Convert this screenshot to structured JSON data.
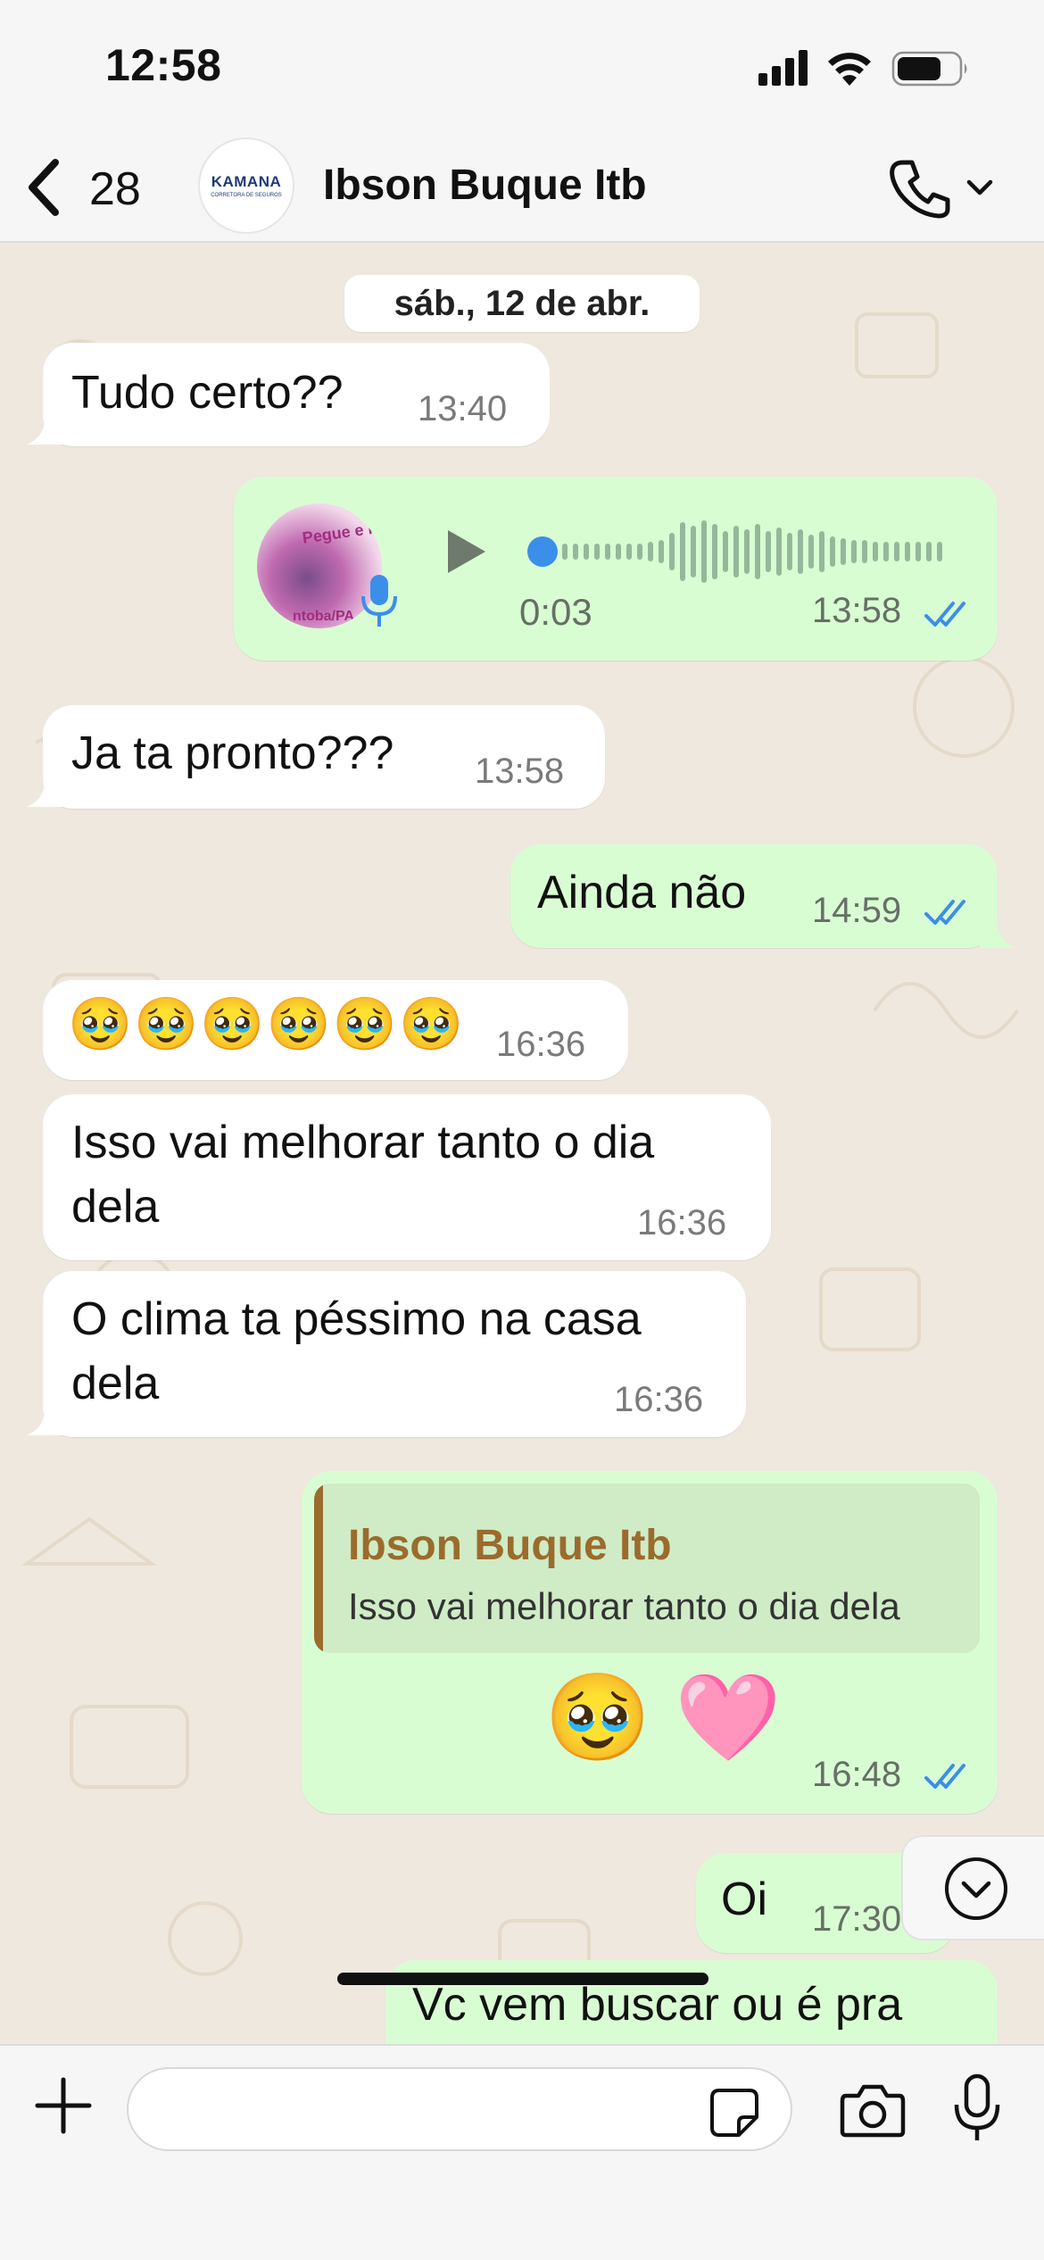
{
  "status_bar": {
    "time": "12:58"
  },
  "header": {
    "back_count": "28",
    "avatar_brand": "KAMANA",
    "avatar_sub": "CORRETORA DE SEGUROS",
    "contact_name": "Ibson Buque Itb"
  },
  "chat": {
    "date_label": "sáb., 12 de abr.",
    "messages": [
      {
        "direction": "in",
        "text": "Tudo certo??",
        "time": "13:40"
      },
      {
        "direction": "out",
        "type": "voice",
        "duration": "0:03",
        "time": "13:58",
        "status": "read",
        "thumb_text_top": "Pegue e M FESTA NA ME",
        "thumb_text_bottom": "ntoba/PA"
      },
      {
        "direction": "in",
        "text": "Ja ta pronto???",
        "time": "13:58"
      },
      {
        "direction": "out",
        "text": "Ainda não",
        "time": "14:59",
        "status": "read"
      },
      {
        "direction": "in",
        "text": "🥹🥹🥹🥹🥹🥹",
        "time": "16:36"
      },
      {
        "direction": "in",
        "text_line1": "Isso vai melhorar tanto o dia",
        "text_line2": "dela",
        "time": "16:36"
      },
      {
        "direction": "in",
        "text_line1": "O clima ta péssimo na casa",
        "text_line2": "dela",
        "time": "16:36"
      },
      {
        "direction": "out",
        "type": "reply",
        "quote_name": "Ibson Buque Itb",
        "quote_text": "Isso vai melhorar tanto o dia dela",
        "text": "🥹 🩷",
        "time": "16:48",
        "status": "read"
      },
      {
        "direction": "out",
        "text": "Oi",
        "time": "17:30"
      },
      {
        "direction": "out",
        "text": "Vc vem buscar ou é pra"
      }
    ]
  },
  "input": {
    "placeholder": "",
    "value": ""
  },
  "colors": {
    "incoming_bubble": "#ffffff",
    "outgoing_bubble": "#d9fdd3",
    "chat_background": "#efe8de",
    "read_ticks": "#3b8eea",
    "quote_accent": "#9b6b2c"
  },
  "icons": [
    "back-chevron-icon",
    "phone-icon",
    "chevron-down-icon",
    "play-icon",
    "mic-icon",
    "double-check-icon",
    "scroll-down-icon",
    "plus-icon",
    "sticker-icon",
    "camera-icon",
    "microphone-icon",
    "signal-icon",
    "wifi-icon",
    "battery-icon"
  ]
}
